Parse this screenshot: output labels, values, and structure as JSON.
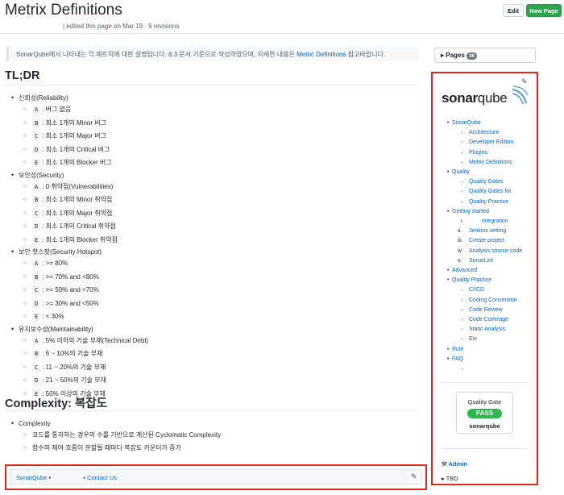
{
  "header": {
    "title": "Metrix Definitions",
    "meta": "| edited this page on Mar 19 · 9 revisions",
    "edit_label": "Edit",
    "new_page_label": "New Page"
  },
  "intro": {
    "text": "SonarQube에서 나타내는 각 매트릭에 대한 설명입니다. 8.3 문서 기준으로 작성하였으며, 자세한 내용은 ",
    "link": "Metric Definitions",
    "suffix": " 참고바랍니다."
  },
  "tldr": {
    "heading": "TL;DR",
    "groups": [
      {
        "label": "신뢰성(Reliability)",
        "items": [
          {
            "code": "A",
            "text": ": 버그 없음"
          },
          {
            "code": "B",
            "text": ": 최소 1개의 Minor 버그"
          },
          {
            "code": "C",
            "text": ": 최소 1개의 Major 버그"
          },
          {
            "code": "D",
            "text": ": 최소 1개의 Critical 버그"
          },
          {
            "code": "E",
            "text": ": 최소 1개의 Blocker 버그"
          }
        ]
      },
      {
        "label": "보안성(Security)",
        "items": [
          {
            "code": "A",
            "text": ": 0 취약점(Vulnerabilities)"
          },
          {
            "code": "B",
            "text": ": 최소 1개의 Minor 취약점"
          },
          {
            "code": "C",
            "text": ": 최소 1개의 Major 취약점"
          },
          {
            "code": "D",
            "text": ": 최소 1개의 Critical 취약점"
          },
          {
            "code": "E",
            "text": ": 최소 1개의 Blocker 취약점"
          }
        ]
      },
      {
        "label": "보안 핫스팟(Security Hotspot)",
        "items": [
          {
            "code": "A",
            "text": ": >= 80%"
          },
          {
            "code": "B",
            "text": ": >= 70% and <80%"
          },
          {
            "code": "C",
            "text": ": >= 50% and <70%"
          },
          {
            "code": "D",
            "text": ": >= 30% and <50%"
          },
          {
            "code": "E",
            "text": ": < 30%"
          }
        ]
      },
      {
        "label": "유지보수성(Maintainability)",
        "items": [
          {
            "code": "A",
            "text": ": 5% 이하의 기술 부채(Technical Debt)"
          },
          {
            "code": "B",
            "text": ": 6 ~ 10%의 기술 부채"
          },
          {
            "code": "C",
            "text": ": 11 ~ 20%의 기술 부채"
          },
          {
            "code": "D",
            "text": ": 21 ~ 50%의 기술 부채"
          },
          {
            "code": "E",
            "text": ": 50% 이상의 기술 부채"
          }
        ]
      }
    ]
  },
  "complexity": {
    "heading": "Complexity: 복잡도",
    "label": "Complexity",
    "items": [
      "코드를 통과하는 경우의 수를 기반으로 계산된 Cyclomatic Complexity",
      "함수의 제어 흐름이 분할될 때마다 복잡도 카운터가 증가"
    ]
  },
  "footer": {
    "link1": "SonarQube",
    "sep1": " • ",
    "sep2": " • ",
    "link2": "Contact Us"
  },
  "sidebar": {
    "pages_label": "Pages",
    "pages_count": "36",
    "logo_sonar": "sonar",
    "logo_qube": "qube",
    "nav": {
      "sonarqube": "SonarQube",
      "sonarqube_items": [
        "Architecture",
        "Developer Edition",
        "Plugins",
        "Metrix Definitions"
      ],
      "quality": "Quality",
      "quality_items": [
        "Quality Gates",
        "Quality Gates for",
        "Quality Practice"
      ],
      "getting_started": "Getting started",
      "getting_items": [
        {
          "num": "i.",
          "text": "integration"
        },
        {
          "num": "ii.",
          "text": "Jenkins setting"
        },
        {
          "num": "iii.",
          "text": "Create project"
        },
        {
          "num": "iv.",
          "text": "Analysis source code"
        },
        {
          "num": "v.",
          "text": "SonarLint"
        }
      ],
      "advanced": "Advanced",
      "quality_practice": "Quality Practice",
      "practice_items": [
        "CI/CD",
        "Coding Convention",
        "Code Review",
        "Code Coverage",
        "Static Analysis",
        "Etc"
      ],
      "rule": "Rule",
      "faq": "FAQ"
    },
    "quality_gate": {
      "title": "Quality Gate",
      "status": "PASS",
      "logo": "sonarqube"
    },
    "admin_label": "Admin",
    "tbd_label": "TBD"
  },
  "colors": {
    "link": "#0366d6",
    "highlight_border": "#e0261b",
    "pass_green": "#2db84d",
    "new_page_green": "#2ea44f"
  }
}
